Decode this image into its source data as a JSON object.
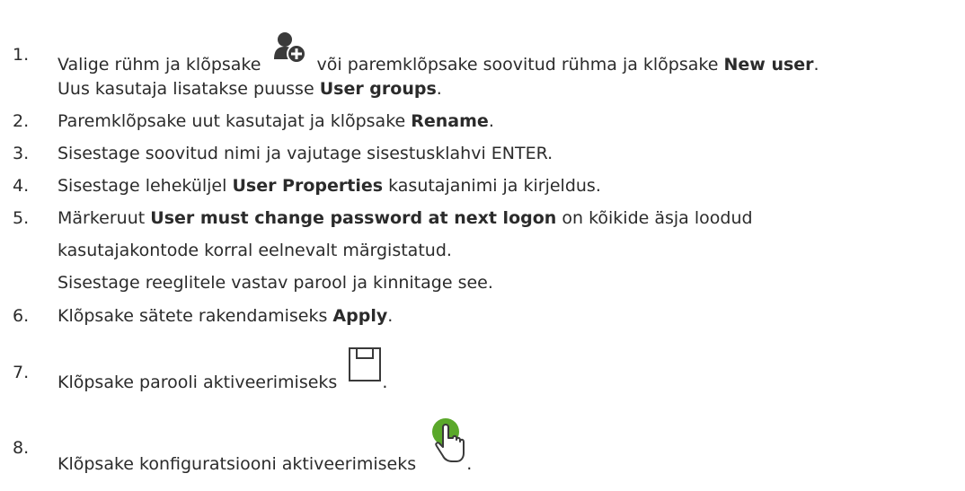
{
  "steps": [
    {
      "number": "1.",
      "line1_a": "Valige rühm ja klõpsake",
      "line1_b": "või paremklõpsake soovitud rühma ja klõpsake",
      "line1_bold": "New user",
      "line1_end": ".",
      "line2_a": "Uus kasutaja lisatakse puusse",
      "line2_bold": "User groups",
      "line2_end": "."
    },
    {
      "number": "2.",
      "text_a": "Paremklõpsake uut kasutajat ja klõpsake",
      "bold": "Rename",
      "text_end": "."
    },
    {
      "number": "3.",
      "text_a": "Sisestage soovitud nimi ja vajutage sisestusklahvi ENTER."
    },
    {
      "number": "4.",
      "text_a": "Sisestage leheküljel",
      "bold": "User Properties",
      "text_end": "kasutajanimi ja kirjeldus."
    },
    {
      "number": "5.",
      "line1_a": "Märkeruut",
      "line1_bold": "User must change password at next logon",
      "line1_end": "on kõikide äsja loodud",
      "line2": "kasutajakontode korral eelnevalt märgistatud.",
      "line3": "Sisestage reeglitele vastav parool ja kinnitage see."
    },
    {
      "number": "6.",
      "text_a": "Klõpsake sätete rakendamiseks",
      "bold": "Apply",
      "text_end": "."
    },
    {
      "number": "7.",
      "text_a": "Klõpsake parooli aktiveerimiseks",
      "text_end": "."
    },
    {
      "number": "8.",
      "text_a": "Klõpsake konfiguratsiooni aktiveerimiseks",
      "text_end": "."
    }
  ],
  "icons": {
    "new_user": "add-user-icon",
    "save": "save-icon",
    "activate": "activate-hand-icon"
  },
  "colors": {
    "text": "#2b2b2b",
    "icon_dark": "#3a3a3a",
    "icon_green": "#5aa82a"
  }
}
